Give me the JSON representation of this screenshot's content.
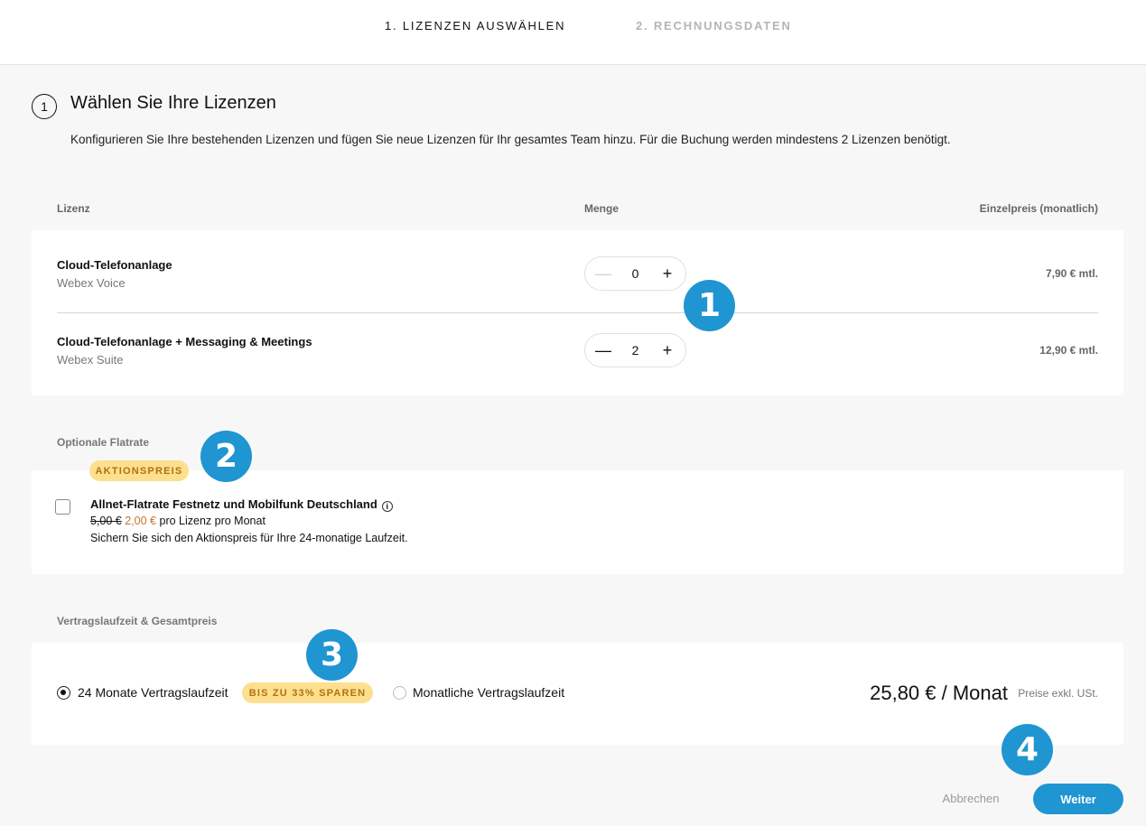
{
  "steps": {
    "step1": "1. LIZENZEN AUSWÄHLEN",
    "step2": "2. RECHNUNGSDATEN"
  },
  "section": {
    "number": "1",
    "title": "Wählen Sie Ihre Lizenzen",
    "description": "Konfigurieren Sie Ihre bestehenden Lizenzen und fügen Sie neue Lizenzen für Ihr gesamtes Team hinzu. Für die Buchung werden mindestens 2 Lizenzen benötigt."
  },
  "table": {
    "headers": {
      "license": "Lizenz",
      "quantity": "Menge",
      "unit_price": "Einzelpreis (monatlich)"
    },
    "rows": [
      {
        "name": "Cloud-Telefonanlage",
        "product": "Webex Voice",
        "quantity": "0",
        "minus": "—",
        "plus": "+",
        "price": "7,90 € mtl."
      },
      {
        "name": "Cloud-Telefonanlage + Messaging & Meetings",
        "product": "Webex Suite",
        "quantity": "2",
        "minus": "—",
        "plus": "+",
        "price": "12,90 € mtl."
      }
    ]
  },
  "flatrate": {
    "section_label": "Optionale Flatrate",
    "badge": "AKTIONSPREIS",
    "title": "Allnet-Flatrate Festnetz und Mobilfunk Deutschland",
    "info_icon": "i",
    "old_price": "5,00 €",
    "new_price": "2,00 €",
    "price_suffix": "pro Lizenz pro Monat",
    "note": "Sichern Sie sich den Aktionspreis für Ihre 24-monatige Laufzeit."
  },
  "contract": {
    "section_label": "Vertragslaufzeit & Gesamtpreis",
    "option_24": "24 Monate Vertragslaufzeit",
    "save_badge": "BIS ZU 33% SPAREN",
    "option_monthly": "Monatliche Vertragslaufzeit",
    "total": "25,80 € / Monat",
    "total_note": "Preise exkl. USt."
  },
  "markers": [
    "1",
    "2",
    "3",
    "4"
  ],
  "actions": {
    "cancel": "Abbrechen",
    "next": "Weiter"
  },
  "colors": {
    "accent": "#1f95d2",
    "badge_bg": "#fddf8d",
    "badge_text": "#b07212",
    "promo_price": "#c7742a"
  }
}
